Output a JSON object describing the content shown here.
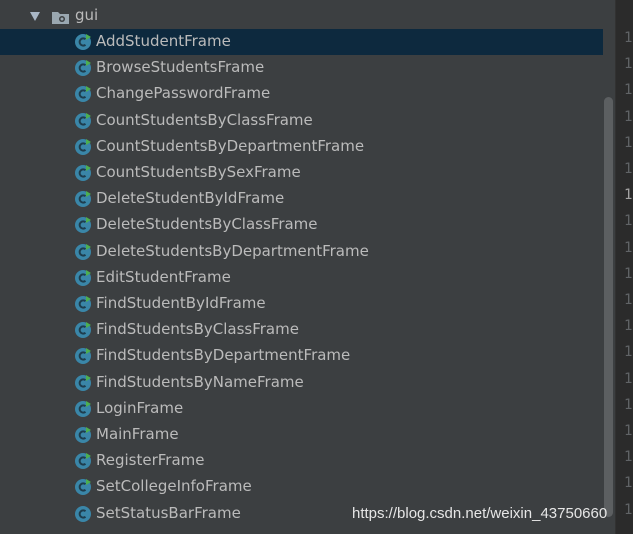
{
  "tree": {
    "folder": {
      "label": "gui",
      "icon": "folder-icon",
      "expand_icon": "chevron-down-icon"
    },
    "items": [
      {
        "label": "AddStudentFrame",
        "icon": "java-class-icon",
        "selected": true
      },
      {
        "label": "BrowseStudentsFrame",
        "icon": "java-class-icon"
      },
      {
        "label": "ChangePasswordFrame",
        "icon": "java-class-icon"
      },
      {
        "label": "CountStudentsByClassFrame",
        "icon": "java-class-icon"
      },
      {
        "label": "CountStudentsByDepartmentFrame",
        "icon": "java-class-icon"
      },
      {
        "label": "CountStudentsBySexFrame",
        "icon": "java-class-icon"
      },
      {
        "label": "DeleteStudentByIdFrame",
        "icon": "java-class-icon"
      },
      {
        "label": "DeleteStudentsByClassFrame",
        "icon": "java-class-icon"
      },
      {
        "label": "DeleteStudentsByDepartmentFrame",
        "icon": "java-class-icon"
      },
      {
        "label": "EditStudentFrame",
        "icon": "java-class-icon"
      },
      {
        "label": "FindStudentByIdFrame",
        "icon": "java-class-icon"
      },
      {
        "label": "FindStudentsByClassFrame",
        "icon": "java-class-icon"
      },
      {
        "label": "FindStudentsByDepartmentFrame",
        "icon": "java-class-icon"
      },
      {
        "label": "FindStudentsByNameFrame",
        "icon": "java-class-icon"
      },
      {
        "label": "LoginFrame",
        "icon": "java-class-icon"
      },
      {
        "label": "MainFrame",
        "icon": "java-class-icon"
      },
      {
        "label": "RegisterFrame",
        "icon": "java-class-icon"
      },
      {
        "label": "SetCollegeInfoFrame",
        "icon": "java-class-icon"
      },
      {
        "label": "SetStatusBarFrame",
        "icon": "java-class-icon",
        "no_badge": true
      }
    ]
  },
  "gutter": {
    "line_numbers": [
      "1",
      "1",
      "1",
      "1",
      "1",
      "1",
      "1",
      "1",
      "1",
      "1",
      "1",
      "1",
      "1",
      "1",
      "1",
      "1",
      "1",
      "1",
      "1"
    ],
    "current_line_index": 6
  },
  "watermark": "https://blog.csdn.net/weixin_43750660",
  "colors": {
    "background": "#3c3f41",
    "selected_row": "#0d293e",
    "text": "#bbbbbb",
    "class_icon": "#3a86a8",
    "badge": "#4caf50"
  }
}
